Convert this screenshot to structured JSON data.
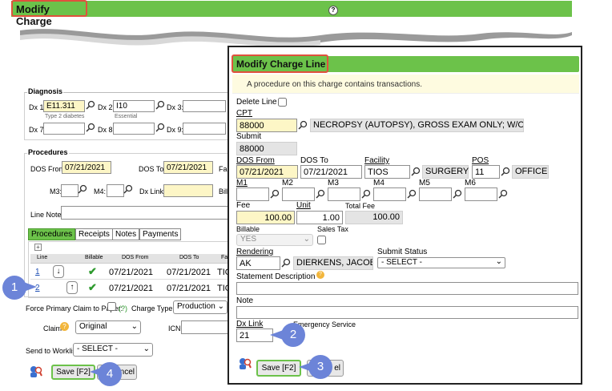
{
  "background": {
    "title": "Modify Charge",
    "help": "?",
    "diagnosis": {
      "legend": "Diagnosis",
      "dx1_label": "Dx 1:",
      "dx1_value": "E11.311",
      "dx1_desc": "Type 2 diabetes",
      "dx2_label": "Dx 2:",
      "dx2_value": "I10",
      "dx2_desc": "Essential",
      "dx3_label": "Dx 3:",
      "dx7_label": "Dx 7:",
      "dx8_label": "Dx 8:",
      "dx9_label": "Dx 9:"
    },
    "procedures": {
      "legend": "Procedures",
      "dos_from_label": "DOS From:",
      "dos_from_value": "07/21/2021",
      "dos_to_label": "DOS To:",
      "dos_to_value": "07/21/2021",
      "fac_label": "Fac",
      "m3_label": "M3:",
      "m4_label": "M4:",
      "dxlink_label": "Dx Link:",
      "bill_label": "Bill",
      "line_note_label": "Line Note:",
      "tabs": [
        "Procedures",
        "Receipts",
        "Notes",
        "Payments"
      ],
      "plus": "+",
      "columns": [
        "Line",
        "",
        "Billable",
        "DOS From",
        "DOS To",
        "Fa"
      ],
      "rows": [
        {
          "line": "1",
          "dos_from": "07/21/2021",
          "dos_to": "07/21/2021",
          "fac": "TIO"
        },
        {
          "line": "2",
          "dos_from": "07/21/2021",
          "dos_to": "07/21/2021",
          "fac": "TIO"
        }
      ]
    },
    "force_label": "Force Primary Claim to Paper:",
    "force_help": "(?)",
    "charge_type_label": "Charge Type:",
    "charge_type_value": "Production",
    "claim_label": "Claim",
    "claim_value": "Original",
    "icn_label": "ICN:",
    "worklist_label": "Send to Worklist:",
    "worklist_value": "- SELECT -",
    "save_label": "Save [F2]",
    "cancel_label": "ncel"
  },
  "dialog": {
    "title": "Modify Charge Line",
    "notice": "A procedure on this charge contains transactions.",
    "delete_line_label": "Delete Line",
    "cpt_label": "CPT",
    "cpt_value": "88000",
    "cpt_desc": "NECROPSY (AUTOPSY), GROSS EXAM ONLY; W/O...",
    "submit_label": "Submit",
    "submit_value": "88000",
    "dos_from_label": "DOS From",
    "dos_from_value": "07/21/2021",
    "dos_to_label": "DOS To",
    "dos_to_value": "07/21/2021",
    "facility_label": "Facility",
    "facility_value": "TIOS",
    "facility_desc": "SURGERY",
    "pos_label": "POS",
    "pos_value": "11",
    "pos_desc": "OFFICE",
    "mods": [
      "M1",
      "M2",
      "M3",
      "M4",
      "M5",
      "M6"
    ],
    "fee_label": "Fee",
    "fee_value": "100.00",
    "unit_label": "Unit",
    "unit_value": "1.00",
    "total_fee_label": "Total Fee",
    "total_fee_value": "100.00",
    "billable_label": "Billable",
    "billable_value": "YES",
    "sales_tax_label": "Sales Tax",
    "rendering_label": "Rendering",
    "rendering_value": "AK",
    "rendering_desc": "DIERKENS, JACOB",
    "submit_status_label": "Submit Status",
    "submit_status_value": "- SELECT -",
    "statement_desc_label": "Statement Description",
    "note_label": "Note",
    "dx_link_label": "Dx Link",
    "dx_link_value": "21",
    "emergency_label": "Emergency Service",
    "save_label": "Save [F2]",
    "cancel_label": "el"
  },
  "callouts": [
    "1",
    "2",
    "3",
    "4"
  ],
  "colors": {
    "green": "#6cc24a",
    "highlight": "#e0513d",
    "callout": "#6c84d8",
    "yellow": "#fdf6c6"
  }
}
